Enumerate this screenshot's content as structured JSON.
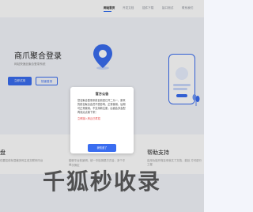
{
  "nav": {
    "items": [
      {
        "label": "网站首页",
        "active": true
      },
      {
        "label": "开发文档",
        "active": false
      },
      {
        "label": "插件下载",
        "active": false
      },
      {
        "label": "接口测试",
        "active": false
      },
      {
        "label": "联系我们",
        "active": false
      }
    ]
  },
  "hero": {
    "title": "商爪聚合登录",
    "subtitle": "网站快速此聚合登录系统",
    "primary_button": "立即试用",
    "secondary_button": "快速登录"
  },
  "features": {
    "left_title": "盘",
    "left_desc": "仅要控前标显著多网主说文联网平台",
    "middle_desc1": "能够平台前景明，统一中检测是方式合，多个平台",
    "middle_desc2": "一次搞定",
    "right_title": "帮助支持",
    "right_desc": "应用功能开程至来就文了文档，能处 方可进行工程"
  },
  "watermark": {
    "text": "千狐秒收录"
  },
  "modal": {
    "title": "官方公告",
    "body": "您名聚合登录系统目前是已开二为一，原来的统名聚合会员不受影响，正常使用，后期可正常使用，不支持新注册，后面会多会配再测点点置下来！",
    "link": "立即接入商云已重招",
    "button": "我知道了"
  },
  "colors": {
    "accent": "#3a6df0",
    "link_red": "#e23b3b"
  }
}
